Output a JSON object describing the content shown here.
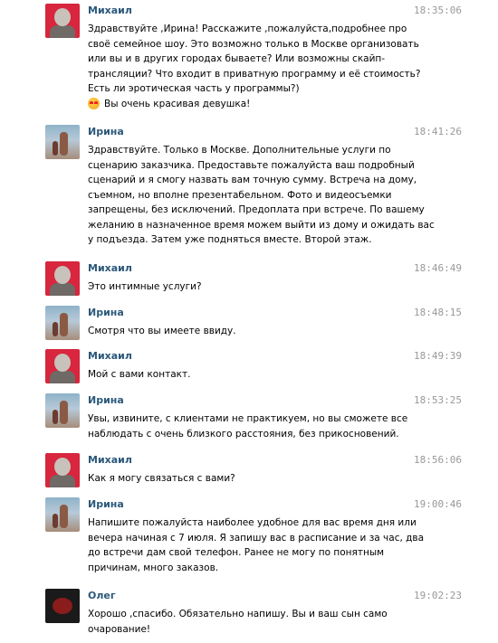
{
  "messages": [
    {
      "author": "Михаил",
      "avatar": "mikhail",
      "time": "18:35:06",
      "lines": [
        "Здравствуйте ,Ирина! Расскажите ,пожалуйста,подробнее про",
        "своё семейное шоу. Это возможно только в Москве организовать",
        "или вы и в других городах бываете? Или возможны скайп-",
        "трансляции? Что входит в приватную программу и её стоимость?",
        "Есть ли эротическая часть у программы?)"
      ],
      "emoji_line": "Вы очень красивая девушка!",
      "emoji_icon": "heart-eyes-emoji"
    },
    {
      "author": "Ирина",
      "avatar": "irina",
      "time": "18:41:26",
      "lines": [
        "Здравствуйте. Только в Москве. Дополнительные услуги по",
        "сценарию заказчика. Предоставьте пожалуйста ваш подробный",
        "сценарий и я смогу назвать вам точную сумму. Встреча на дому,",
        "съемном, но вполне презентабельном. Фото и видеосъемки",
        "запрещены, без исключений. Предоплата при встрече. По вашему",
        "желанию в назначенное время можем выйти из дому и ожидать вас",
        "у подъезда. Затем уже подняться вместе. Второй этаж."
      ]
    },
    {
      "author": "Михаил",
      "avatar": "mikhail",
      "time": "18:46:49",
      "lines": [
        "Это интимные услуги?"
      ]
    },
    {
      "author": "Ирина",
      "avatar": "irina",
      "time": "18:48:15",
      "lines": [
        "Смотря что вы имеете ввиду."
      ]
    },
    {
      "author": "Михаил",
      "avatar": "mikhail",
      "time": "18:49:39",
      "lines": [
        "Мой с вами контакт."
      ]
    },
    {
      "author": "Ирина",
      "avatar": "irina",
      "time": "18:53:25",
      "lines": [
        "Увы, извините, с клиентами не практикуем, но вы сможете все",
        "наблюдать с очень близкого расстояния, без прикосновений."
      ]
    },
    {
      "author": "Михаил",
      "avatar": "mikhail",
      "time": "18:56:06",
      "lines": [
        "Как я могу связаться с вами?"
      ]
    },
    {
      "author": "Ирина",
      "avatar": "irina",
      "time": "19:00:46",
      "lines": [
        "Напишите пожалуйста наиболее удобное для вас время дня или",
        "вечера начиная с 7 июля. Я запишу вас в расписание и за час, два",
        "до встречи дам свой телефон. Ранее не могу по понятным",
        "причинам, много заказов."
      ]
    },
    {
      "author": "Олег",
      "avatar": "oleg",
      "time": "19:02:23",
      "lines": [
        "Хорошо ,спасибо. Обязательно напишу. Вы и ваш сын само",
        "очарование!"
      ]
    }
  ]
}
